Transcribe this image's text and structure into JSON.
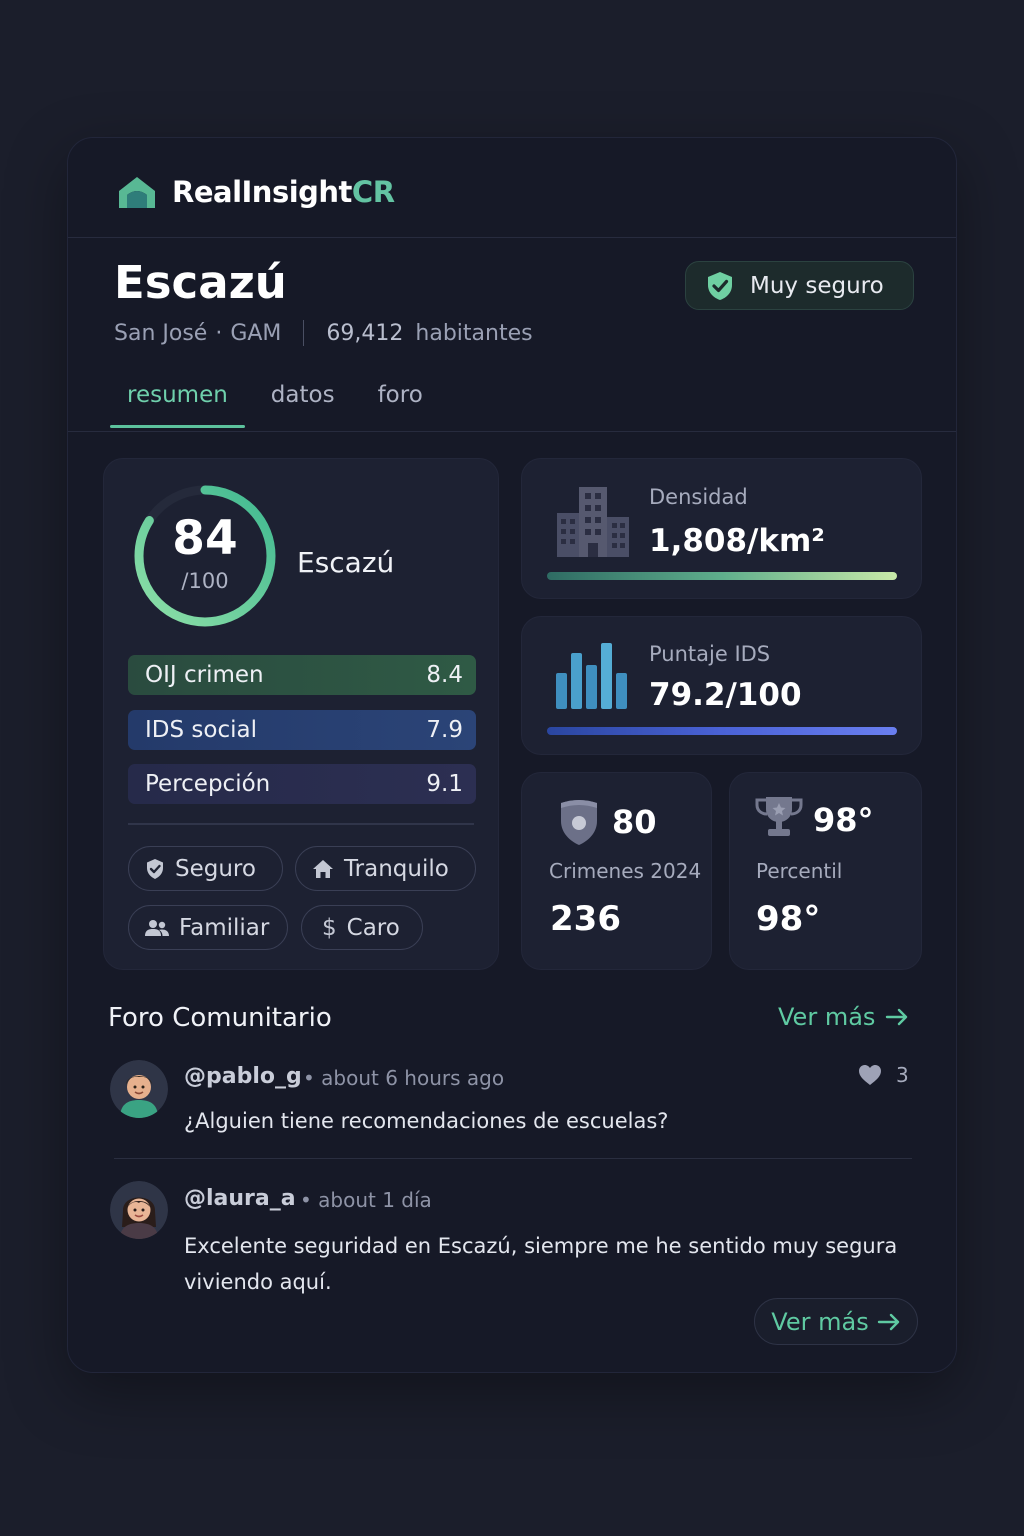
{
  "brand": {
    "name_main": "RealInsight",
    "name_accent": "CR",
    "icon": "house-logo-icon"
  },
  "location": {
    "name": "Escazú",
    "province": "San José",
    "region": "GAM",
    "population": "69,412",
    "population_label": "habitantes",
    "safety_badge": "Muy seguro"
  },
  "tabs": [
    {
      "label": "resumen",
      "active": true
    },
    {
      "label": "datos",
      "active": false
    },
    {
      "label": "foro",
      "active": false
    }
  ],
  "score": {
    "value": "84",
    "max_label": "/100",
    "fraction": 0.84,
    "name": "Escazú",
    "bars": [
      {
        "label": "OIJ crimen",
        "value": "8.4"
      },
      {
        "label": "IDS social",
        "value": "7.9"
      },
      {
        "label": "Percepción",
        "value": "9.1"
      }
    ],
    "tags": [
      {
        "label": "Seguro",
        "icon": "shield-check-icon"
      },
      {
        "label": "Tranquilo",
        "icon": "home-icon"
      },
      {
        "label": "Familiar",
        "icon": "people-icon"
      },
      {
        "label": "Caro",
        "icon": "dollar-icon"
      }
    ]
  },
  "stats": {
    "density": {
      "label": "Densidad",
      "value": "1,808/km²",
      "icon": "buildings-icon"
    },
    "ids": {
      "label": "Puntaje IDS",
      "value": "79.2/100",
      "icon": "bar-chart-icon"
    },
    "crimes": {
      "big": "80",
      "label": "Crimenes 2024",
      "value": "236",
      "icon": "police-badge-icon"
    },
    "percentile": {
      "big": "98°",
      "label": "Percentil",
      "value": "98°",
      "icon": "trophy-icon"
    }
  },
  "forum": {
    "title": "Foro Comunitario",
    "see_more": "Ver más",
    "posts": [
      {
        "user": "@pablo_g",
        "time": "• about 6 hours ago",
        "text": "¿Alguien tiene recomendaciones de escuelas?",
        "likes": "3"
      },
      {
        "user": "@laura_a",
        "time": "• about 1 día",
        "text": "Excelente seguridad en Escazú, siempre me he sentido muy segura viviendo aquí."
      }
    ],
    "see_more_button": "Ver más"
  },
  "colors": {
    "accent": "#5fcaa2",
    "background": "#1b1e2b",
    "card": "#161927",
    "panel": "#1d2132"
  }
}
